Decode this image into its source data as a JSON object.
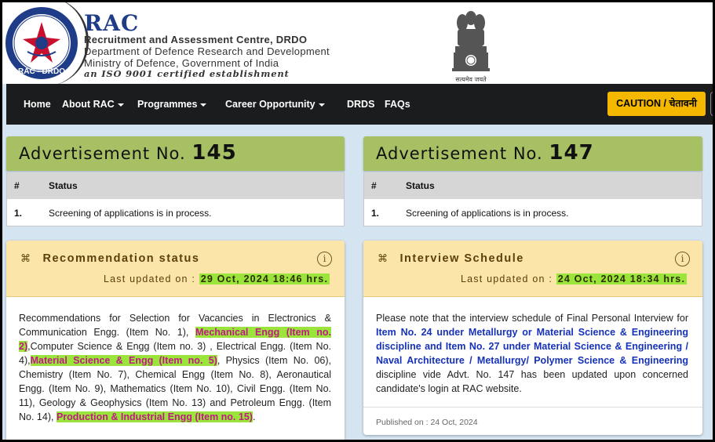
{
  "header": {
    "logo_label": "RAC - DRDO",
    "title": "RAC",
    "line1": "Recruitment and Assessment Centre, DRDO",
    "line2": "Department of Defence Research and Development",
    "line3": "Ministry of Defence, Government of India",
    "line4": "an ISO 9001 certified establishment",
    "emblem_caption": "सत्यमेव जयते"
  },
  "nav": {
    "items": [
      {
        "label": "Home"
      },
      {
        "label": "About RAC"
      },
      {
        "label": "Programmes"
      },
      {
        "label": "Career Opportunity"
      },
      {
        "label": "DRDS"
      },
      {
        "label": "FAQs"
      }
    ],
    "caution_label": "CAUTION / चेतावनी"
  },
  "adv145": {
    "prefix": "Advertisement No.",
    "number": "145",
    "col_num": "#",
    "col_status": "Status",
    "row_num": "1.",
    "row_status": "Screening of applications is in process."
  },
  "adv147": {
    "prefix": "Advertisement No.",
    "number": "147",
    "col_num": "#",
    "col_status": "Status",
    "row_num": "1.",
    "row_status": "Screening of applications is in process."
  },
  "recommendation": {
    "title": "Recommendation status",
    "updated_label": "Last updated on :",
    "updated_value": "29 Oct, 2024 18:46 hrs.",
    "t1": "Recommendations for Selection for Vacancies in Electronics & Communication Engg. (Item No. 1), ",
    "h1": "Mechanical Engg (Item no. 2)",
    "t2": ",Computer Science & Engg (Item no. 3) , Electrical Engg. (Item No. 4),",
    "h2": "Material Science & Engg (Item no. 5)",
    "t3": ", Physics (Item No. 06), Chemistry (Item No. 7), Chemical Engg (Item No. 8), Aeronautical Engg. (Item No. 9), Mathematics (Item No. 10), Civil Engg. (Item No. 11), Geology & Geophysics (Item No. 13) and Petroleum Engg. (Item No. 14), ",
    "h3": "Production & Industrial Engg (Item no. 15)",
    "t4": "."
  },
  "interview": {
    "title": "Interview Schedule",
    "updated_label": "Last updated on :",
    "updated_value": "24 Oct, 2024 18:34 hrs.",
    "t1": "Please note that the interview schedule of Final Personal Interview for ",
    "b1": "Item No. 24 under Metallurgy or Material Science & Engineering discipline and Item No. 27 under Material Science & Engineering / Naval Architecture / Metallurgy/ Polymer Science & Engineering",
    "t2": " discipline vide Advt. No. 147 has been updated upon concerned candidate's login at RAC website.",
    "published": "Published on : 24 Oct, 2024"
  },
  "colors": {
    "nav_bg": "#1a1c1e",
    "caution_bg": "#f5b800",
    "adv_head_bg": "#a6c063",
    "card_head_bg": "#fbe5a8",
    "highlight": "#9be43c",
    "link_blue": "#1632b8",
    "highlight_text_pink": "#c01884"
  }
}
